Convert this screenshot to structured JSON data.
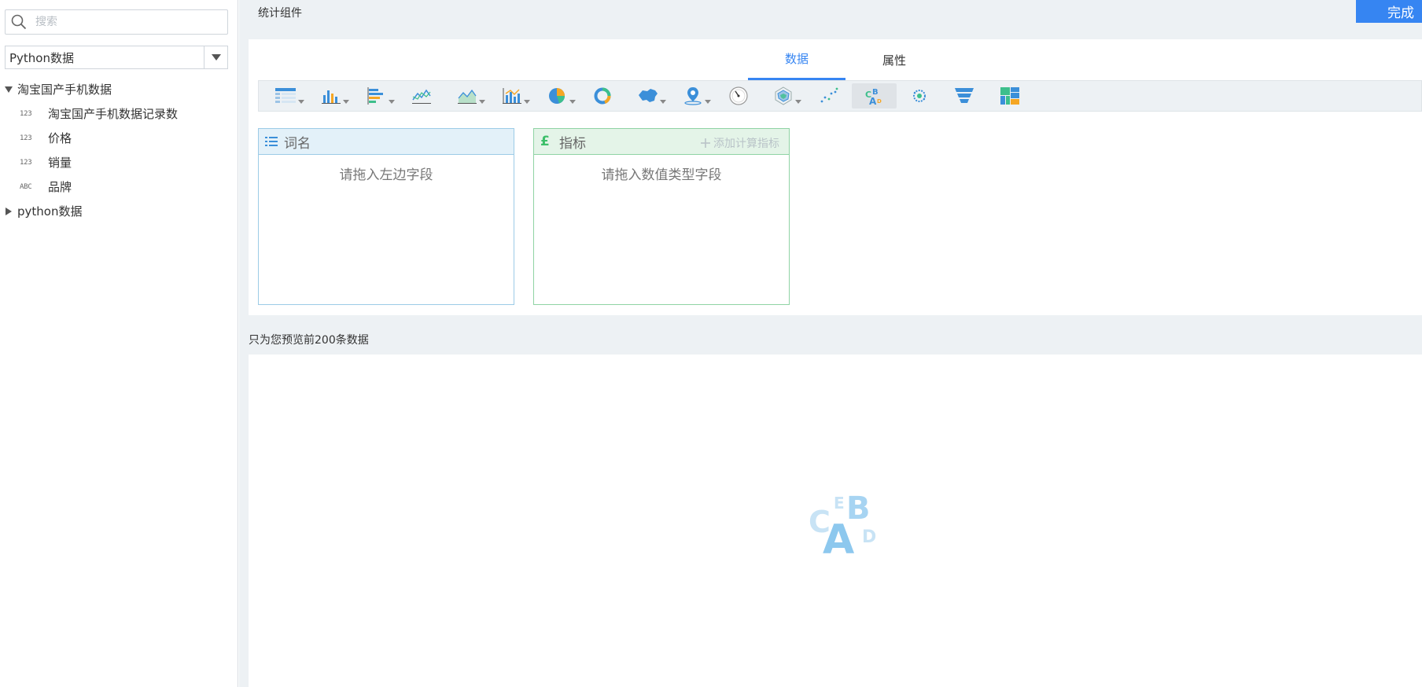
{
  "sidebar": {
    "search": {
      "placeholder": "搜索"
    },
    "datasource": {
      "selected": "Python数据"
    },
    "tree": {
      "group1": {
        "label": "淘宝国产手机数据",
        "expanded": true
      },
      "fields": [
        {
          "type": "123",
          "label": "淘宝国产手机数据记录数"
        },
        {
          "type": "123",
          "label": "价格"
        },
        {
          "type": "123",
          "label": "销量"
        },
        {
          "type": "ABC",
          "label": "品牌"
        }
      ],
      "group2": {
        "label": "python数据",
        "expanded": false
      }
    }
  },
  "header": {
    "title": "统计组件",
    "done_label": "完成"
  },
  "tabs": [
    {
      "label": "数据",
      "active": true
    },
    {
      "label": "属性",
      "active": false
    }
  ],
  "toolbar": {
    "tools": [
      {
        "icon": "table-chart-icon",
        "dropdown": true
      },
      {
        "icon": "bar-chart-icon",
        "dropdown": true
      },
      {
        "icon": "horizontal-bar-chart-icon",
        "dropdown": true
      },
      {
        "icon": "line-chart-icon",
        "dropdown": false
      },
      {
        "icon": "area-chart-icon",
        "dropdown": true
      },
      {
        "icon": "combo-chart-icon",
        "dropdown": true
      },
      {
        "icon": "pie-chart-icon",
        "dropdown": true
      },
      {
        "icon": "donut-chart-icon",
        "dropdown": false
      },
      {
        "icon": "map-chart-icon",
        "dropdown": true
      },
      {
        "icon": "location-map-icon",
        "dropdown": true
      },
      {
        "icon": "gauge-chart-icon",
        "dropdown": false
      },
      {
        "icon": "radar-chart-icon",
        "dropdown": true
      },
      {
        "icon": "scatter-chart-icon",
        "dropdown": false
      },
      {
        "icon": "word-cloud-icon",
        "dropdown": false,
        "selected": true
      },
      {
        "icon": "force-graph-icon",
        "dropdown": false
      },
      {
        "icon": "funnel-chart-icon",
        "dropdown": false
      },
      {
        "icon": "rect-tree-icon",
        "dropdown": false
      }
    ]
  },
  "dimension_box": {
    "title": "词名",
    "hint": "请拖入左边字段"
  },
  "metric_box": {
    "title": "指标",
    "add_label": "添加计算指标",
    "hint": "请拖入数值类型字段"
  },
  "preview": {
    "note": "只为您预览前200条数据"
  },
  "colors": {
    "accent": "#3685f2",
    "dimension": "#9ccbe6",
    "metric": "#8fd3a4"
  }
}
